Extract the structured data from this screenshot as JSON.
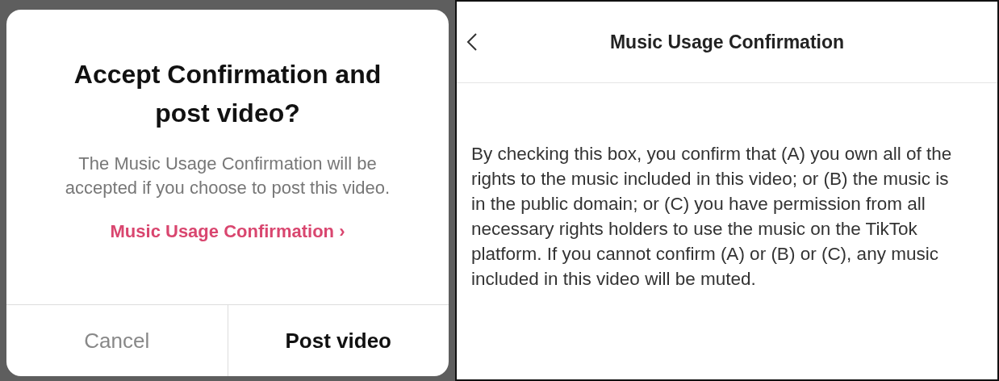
{
  "dialog": {
    "title": "Accept Confirmation and post video?",
    "message": "The Music Usage Confirmation will be accepted if you choose to post this video.",
    "link": "Music Usage Confirmation ›",
    "buttons": [
      {
        "label": "Cancel",
        "kind": "secondary"
      },
      {
        "label": "Post video",
        "kind": "primary"
      }
    ]
  },
  "page": {
    "title": "Music Usage Confirmation",
    "body": "By checking this box, you confirm that (A) you own all of the rights to the music included in this video; or (B) the music is in the public domain; or (C) you have permission from all necessary rights holders to use the music on the TikTok platform. If you cannot confirm (A) or (B) or (C), any music included in this video will be muted."
  }
}
